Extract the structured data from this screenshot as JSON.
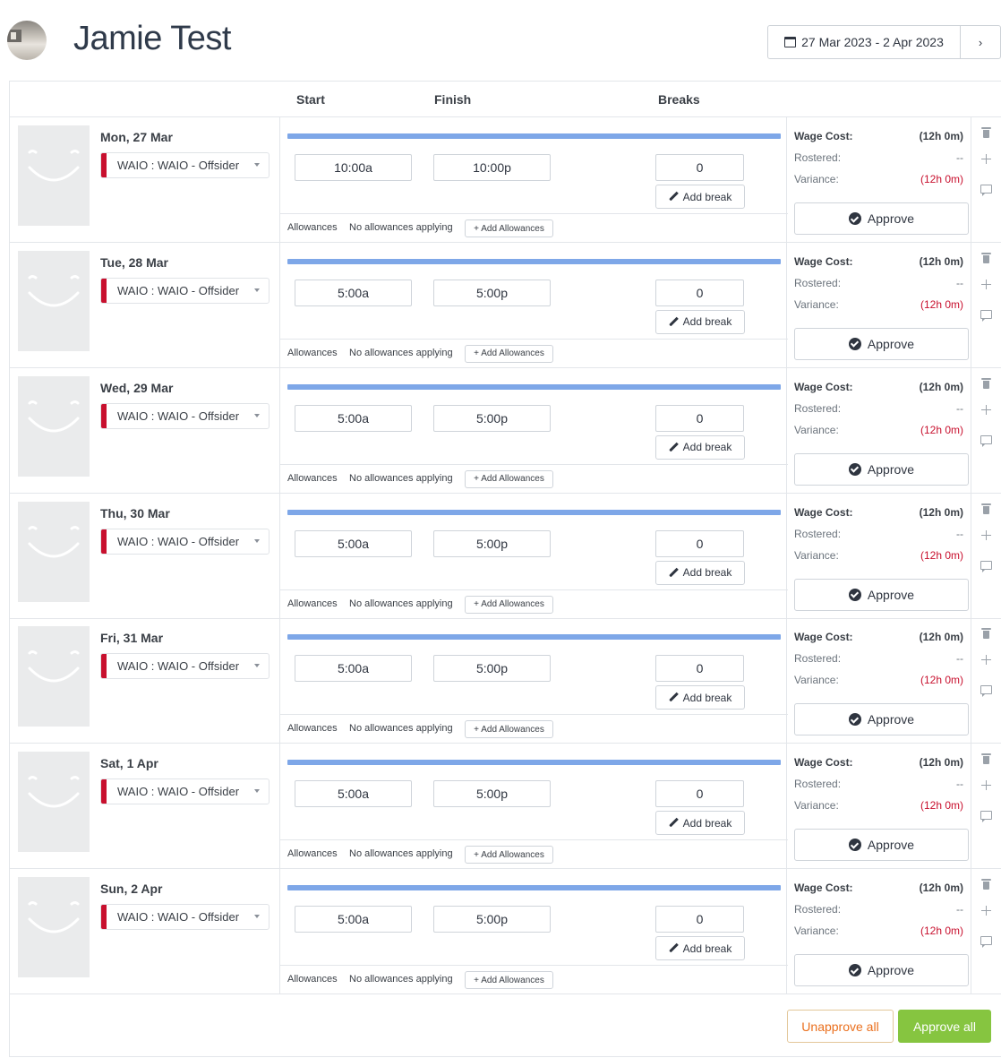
{
  "employee": {
    "name": "Jamie Test"
  },
  "date_range": {
    "label": "27 Mar 2023 - 2 Apr 2023",
    "next": "›"
  },
  "columns": {
    "start": "Start",
    "finish": "Finish",
    "breaks": "Breaks"
  },
  "labels": {
    "allowances": "Allowances",
    "no_allowances": "No allowances applying",
    "add_allowances": "+ Add Allowances",
    "add_break": "Add break",
    "wage_cost": "Wage Cost:",
    "rostered": "Rostered:",
    "variance": "Variance:",
    "approve": "Approve"
  },
  "rows": [
    {
      "day": "Mon, 27 Mar",
      "role": "WAIO : WAIO - Offsider",
      "start": "10:00a",
      "finish": "10:00p",
      "breaks": "0",
      "wage_cost": "(12h 0m)",
      "rostered": "--",
      "variance": "(12h 0m)"
    },
    {
      "day": "Tue, 28 Mar",
      "role": "WAIO : WAIO - Offsider",
      "start": "5:00a",
      "finish": "5:00p",
      "breaks": "0",
      "wage_cost": "(12h 0m)",
      "rostered": "--",
      "variance": "(12h 0m)"
    },
    {
      "day": "Wed, 29 Mar",
      "role": "WAIO : WAIO - Offsider",
      "start": "5:00a",
      "finish": "5:00p",
      "breaks": "0",
      "wage_cost": "(12h 0m)",
      "rostered": "--",
      "variance": "(12h 0m)"
    },
    {
      "day": "Thu, 30 Mar",
      "role": "WAIO : WAIO - Offsider",
      "start": "5:00a",
      "finish": "5:00p",
      "breaks": "0",
      "wage_cost": "(12h 0m)",
      "rostered": "--",
      "variance": "(12h 0m)"
    },
    {
      "day": "Fri, 31 Mar",
      "role": "WAIO : WAIO - Offsider",
      "start": "5:00a",
      "finish": "5:00p",
      "breaks": "0",
      "wage_cost": "(12h 0m)",
      "rostered": "--",
      "variance": "(12h 0m)"
    },
    {
      "day": "Sat, 1 Apr",
      "role": "WAIO : WAIO - Offsider",
      "start": "5:00a",
      "finish": "5:00p",
      "breaks": "0",
      "wage_cost": "(12h 0m)",
      "rostered": "--",
      "variance": "(12h 0m)"
    },
    {
      "day": "Sun, 2 Apr",
      "role": "WAIO : WAIO - Offsider",
      "start": "5:00a",
      "finish": "5:00p",
      "breaks": "0",
      "wage_cost": "(12h 0m)",
      "rostered": "--",
      "variance": "(12h 0m)"
    }
  ],
  "footer": {
    "unapprove_all": "Unapprove all",
    "approve_all": "Approve all"
  },
  "colors": {
    "role_marker": "#c8102e",
    "timeline": "#7ea7e8",
    "variance": "#c8102e",
    "unapprove": "#ea6f1d",
    "approve_all_bg": "#86c540"
  },
  "icons": [
    "calendar-icon",
    "chevron-right-icon",
    "pencil-icon",
    "check-circle-icon",
    "trash-icon",
    "plus-icon",
    "comment-icon",
    "caret-down-icon"
  ]
}
